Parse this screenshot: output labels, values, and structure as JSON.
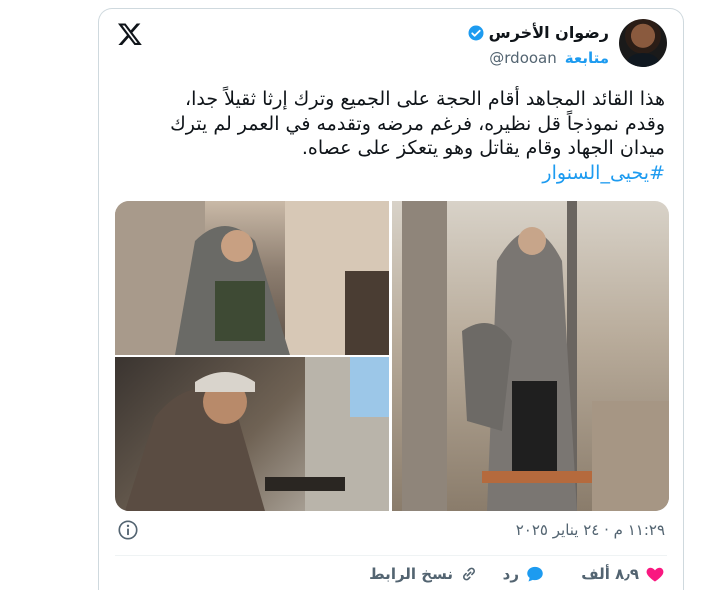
{
  "tweet": {
    "author_name": "رضوان الأخرس",
    "handle": "@rdooan",
    "follow_label": "متابعة",
    "text_lines": [
      "هذا القائد المجاهد أقام الحجة على الجميع وترك إرثا ثقيلاً جدا،",
      "وقدم نموذجاً قل نظيره، فرغم مرضه وتقدمه في العمر لم يترك",
      "ميدان الجهاد وقام يقاتل وهو يتعكز على عصاه."
    ],
    "hashtag": "#يحيى_السنوار",
    "timestamp": "١١:٢٩ م · ٢٤ يناير ٢٠٢٥",
    "likes": "٨٫٩ ألف",
    "reply_label": "رد",
    "copy_link_label": "نسخ الرابط"
  },
  "icons": [
    "x-logo-icon",
    "verified-icon",
    "info-icon",
    "heart-icon",
    "reply-icon",
    "link-icon"
  ],
  "colors": {
    "accent": "#1d9bf0",
    "like": "#f91880",
    "text": "#0f1419",
    "muted": "#536471"
  }
}
